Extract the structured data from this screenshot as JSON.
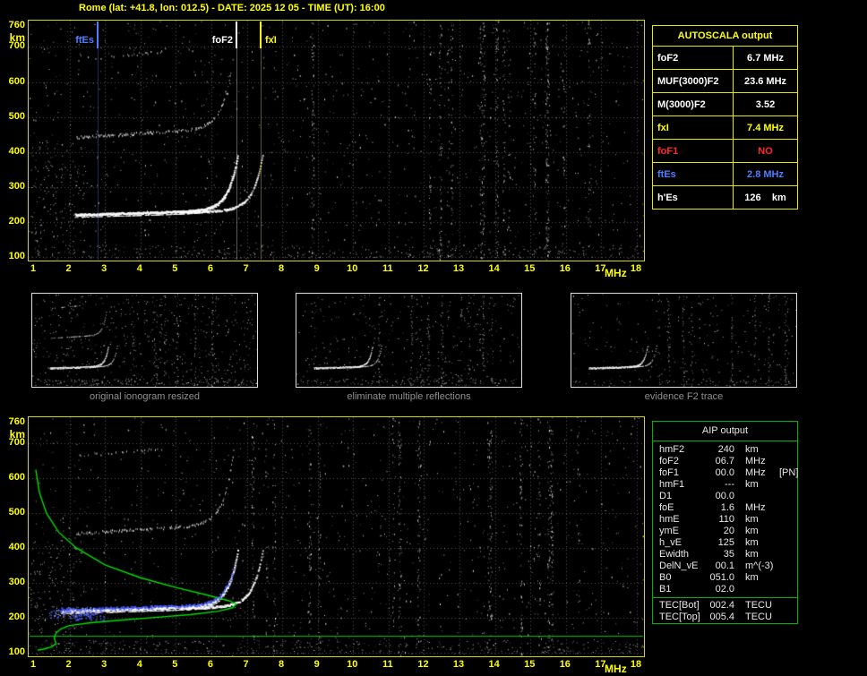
{
  "title": "Rome (lat: +41.8, lon: 012.5) - DATE: 2025 12 05 - TIME (UT): 16:00",
  "autoscala_table": {
    "header": "AUTOSCALA output",
    "rows": [
      {
        "name": "foF2",
        "value": "6.7 MHz",
        "color": "#ffffff"
      },
      {
        "name": "MUF(3000)F2",
        "value": "23.6 MHz",
        "color": "#ffffff"
      },
      {
        "name": "M(3000)F2",
        "value": "3.52",
        "color": "#ffffff"
      },
      {
        "name": "fxI",
        "value": "7.4 MHz",
        "color": "#ffff00"
      },
      {
        "name": "foF1",
        "value": "NO",
        "color": "#ff2a2a"
      },
      {
        "name": "ftEs",
        "value": "2.8 MHz",
        "color": "#4f7dff"
      },
      {
        "name": "h'Es",
        "value": "126    km",
        "color": "#ffffff"
      }
    ]
  },
  "thumbnails": [
    {
      "caption": "original ionogram resized"
    },
    {
      "caption": "eliminate multiple reflections"
    },
    {
      "caption": "evidence F2 trace"
    }
  ],
  "aip_table": {
    "header": "AIP output",
    "rows": [
      {
        "name": "hmF2",
        "value": "240",
        "unit": "km",
        "extra": ""
      },
      {
        "name": "foF2",
        "value": "06.7",
        "unit": "MHz",
        "extra": ""
      },
      {
        "name": "foF1",
        "value": "00.0",
        "unit": "MHz",
        "extra": "[PN]"
      },
      {
        "name": "hmF1",
        "value": "---",
        "unit": "km",
        "extra": ""
      },
      {
        "name": "D1",
        "value": "00.0",
        "unit": "",
        "extra": ""
      },
      {
        "name": "foE",
        "value": "1.6",
        "unit": "MHz",
        "extra": ""
      },
      {
        "name": "hmE",
        "value": "110",
        "unit": "km",
        "extra": ""
      },
      {
        "name": "ymE",
        "value": "20",
        "unit": "km",
        "extra": ""
      },
      {
        "name": "h_vE",
        "value": "125",
        "unit": "km",
        "extra": ""
      },
      {
        "name": "Ewidth",
        "value": "35",
        "unit": "km",
        "extra": ""
      },
      {
        "name": "DelN_vE",
        "value": "00.1",
        "unit": "m^(-3)",
        "extra": ""
      },
      {
        "name": "B0",
        "value": "051.0",
        "unit": "km",
        "extra": ""
      },
      {
        "name": "B1",
        "value": "02.0",
        "unit": "",
        "extra": ""
      }
    ],
    "tec_rows": [
      {
        "name": "TEC[Bot]",
        "value": "002.4",
        "unit": "TECU",
        "extra": ""
      },
      {
        "name": "TEC[Top]",
        "value": "005.4",
        "unit": "TECU",
        "extra": ""
      }
    ]
  },
  "chart_data": {
    "type": "scatter",
    "title": "ionogram (virtual height vs sounding frequency)",
    "xlabel": "MHz",
    "ylabel": "km",
    "xlim": [
      1,
      18
    ],
    "ylim": [
      100,
      760
    ],
    "grid": true,
    "x_ticks": [
      "1",
      "2",
      "3",
      "4",
      "5",
      "6",
      "7",
      "8",
      "9",
      "10",
      "11",
      "12",
      "13",
      "14",
      "15",
      "16",
      "17",
      "18"
    ],
    "y_ticks": [
      "760",
      "700",
      "600",
      "500",
      "400",
      "300",
      "200",
      "100"
    ],
    "markers": [
      {
        "label": "ftEs",
        "freq_mhz": 2.8,
        "color": "#4f7dff",
        "side": "left"
      },
      {
        "label": "foF2",
        "freq_mhz": 6.7,
        "color": "#ffffff",
        "side": "left"
      },
      {
        "label": "fxI",
        "freq_mhz": 7.4,
        "color": "#ffff00",
        "side": "right"
      }
    ],
    "f2_trace": {
      "foF2_mhz": 6.7,
      "fxI_mhz": 7.4,
      "min_virtual_height_km": 222,
      "second_order_visible": true
    },
    "profile_points_f_mhz_h_km": [
      [
        1.05,
        625
      ],
      [
        1.15,
        560
      ],
      [
        1.35,
        500
      ],
      [
        1.7,
        445
      ],
      [
        2.2,
        400
      ],
      [
        3.0,
        352
      ],
      [
        4.0,
        315
      ],
      [
        5.0,
        287
      ],
      [
        5.9,
        265
      ],
      [
        6.5,
        249
      ],
      [
        6.7,
        240
      ],
      [
        6.6,
        229
      ],
      [
        6.2,
        219
      ],
      [
        5.4,
        209
      ],
      [
        4.4,
        201
      ],
      [
        3.4,
        193
      ],
      [
        2.6,
        186
      ],
      [
        2.0,
        178
      ],
      [
        1.75,
        168
      ],
      [
        1.62,
        156
      ],
      [
        1.57,
        143
      ],
      [
        1.6,
        132
      ],
      [
        1.62,
        126
      ],
      [
        1.5,
        117
      ],
      [
        1.3,
        111
      ],
      [
        1.1,
        107
      ]
    ],
    "e_valley_line_km": 148
  }
}
